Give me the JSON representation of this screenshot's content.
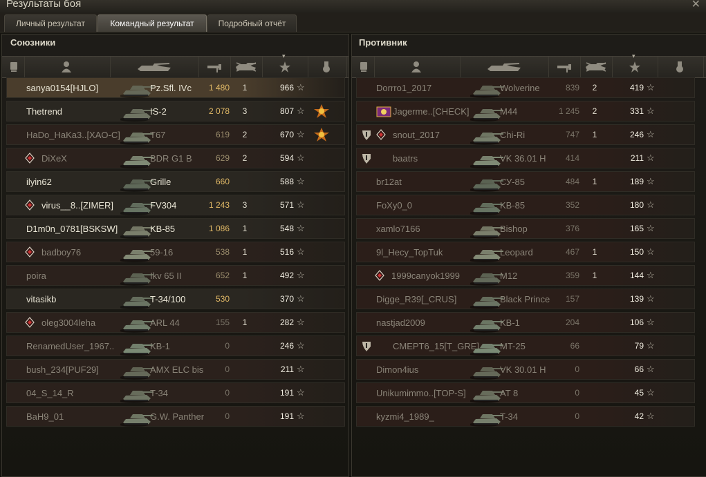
{
  "window": {
    "title": "Результаты боя",
    "close_glyph": "✕"
  },
  "tabs": [
    {
      "label": "Личный результат",
      "active": false
    },
    {
      "label": "Командный результат",
      "active": true
    },
    {
      "label": "Подробный отчёт",
      "active": false
    }
  ],
  "columns": [
    "platoon-icon",
    "player-icon",
    "vehicle-icon",
    "damage-icon",
    "frags-icon",
    "xp-star-icon",
    "medal-icon"
  ],
  "allies": {
    "title": "Союзники",
    "rows": [
      {
        "name": "sanya0154[HJLO]",
        "vehicle": "Pz.Sfl. IVc",
        "damage": "1 480",
        "kills": "1",
        "xp": "966",
        "icon": "",
        "medal": false,
        "player": true
      },
      {
        "name": "Thetrend",
        "vehicle": "IS-2",
        "damage": "2 078",
        "kills": "3",
        "xp": "807",
        "icon": "",
        "medal": true,
        "player": false
      },
      {
        "name": "HaDo_HaKa3..[XAO-C]",
        "vehicle": "T67",
        "damage": "619",
        "kills": "2",
        "xp": "670",
        "icon": "",
        "medal": true,
        "player": false,
        "dead": true
      },
      {
        "name": "DiXeX",
        "vehicle": "BDR G1 B",
        "damage": "629",
        "kills": "2",
        "xp": "594",
        "icon": "diamond",
        "medal": false,
        "player": false,
        "dead": true
      },
      {
        "name": "ilyin62",
        "vehicle": "Grille",
        "damage": "660",
        "kills": "",
        "xp": "588",
        "icon": "",
        "medal": false,
        "player": false
      },
      {
        "name": "virus__8..[ZIMER]",
        "vehicle": "FV304",
        "damage": "1 243",
        "kills": "3",
        "xp": "571",
        "icon": "diamond",
        "medal": false,
        "player": false
      },
      {
        "name": "D1m0n_0781[BSKSW]",
        "vehicle": "KB-85",
        "damage": "1 086",
        "kills": "1",
        "xp": "548",
        "icon": "",
        "medal": false,
        "player": false
      },
      {
        "name": "badboy76",
        "vehicle": "59-16",
        "damage": "538",
        "kills": "1",
        "xp": "516",
        "icon": "diamond",
        "medal": false,
        "player": false,
        "dead": true
      },
      {
        "name": "poira",
        "vehicle": "Ikv 65 II",
        "damage": "652",
        "kills": "1",
        "xp": "492",
        "icon": "",
        "medal": false,
        "player": false,
        "dead": true
      },
      {
        "name": "vitasikb",
        "vehicle": "T-34/100",
        "damage": "530",
        "kills": "",
        "xp": "370",
        "icon": "",
        "medal": false,
        "player": false
      },
      {
        "name": "oleg3004leha",
        "vehicle": "ARL 44",
        "damage": "155",
        "kills": "1",
        "xp": "282",
        "icon": "diamond",
        "medal": false,
        "player": false,
        "dead": true
      },
      {
        "name": "RenamedUser_1967..",
        "vehicle": "KB-1",
        "damage": "0",
        "kills": "",
        "xp": "246",
        "icon": "",
        "medal": false,
        "player": false,
        "dead": true
      },
      {
        "name": "bush_234[PUF29]",
        "vehicle": "AMX ELC bis",
        "damage": "0",
        "kills": "",
        "xp": "211",
        "icon": "",
        "medal": false,
        "player": false,
        "dead": true
      },
      {
        "name": "04_S_14_R",
        "vehicle": "T-34",
        "damage": "0",
        "kills": "",
        "xp": "191",
        "icon": "",
        "medal": false,
        "player": false,
        "dead": true
      },
      {
        "name": "BaH9_01",
        "vehicle": "G.W. Panther",
        "damage": "0",
        "kills": "",
        "xp": "191",
        "icon": "",
        "medal": false,
        "player": false,
        "dead": true
      }
    ]
  },
  "enemies": {
    "title": "Противник",
    "rows": [
      {
        "name": "Dorrro1_2017",
        "vehicle": "Wolverine",
        "damage": "839",
        "kills": "2",
        "xp": "419",
        "icon": "",
        "dead": true
      },
      {
        "name": "Jagerme..[CHECK]",
        "vehicle": "M44",
        "damage": "1 245",
        "kills": "2",
        "xp": "331",
        "icon": "clan",
        "dead": true
      },
      {
        "name": "snout_2017",
        "vehicle": "Chi-Ri",
        "damage": "747",
        "kills": "1",
        "xp": "246",
        "icon": "diamond",
        "badge": "shield",
        "dead": true
      },
      {
        "name": "baatrs",
        "vehicle": "VK 36.01 H",
        "damage": "414",
        "kills": "",
        "xp": "211",
        "icon": "",
        "badge": "shield",
        "dead": true
      },
      {
        "name": "br12at",
        "vehicle": "СУ-85",
        "damage": "484",
        "kills": "1",
        "xp": "189",
        "icon": "",
        "dead": true
      },
      {
        "name": "FoXy0_0",
        "vehicle": "KB-85",
        "damage": "352",
        "kills": "",
        "xp": "180",
        "icon": "",
        "dead": true
      },
      {
        "name": "xamlo7166",
        "vehicle": "Bishop",
        "damage": "376",
        "kills": "",
        "xp": "165",
        "icon": "",
        "dead": true
      },
      {
        "name": "9l_Hecy_TopTuk",
        "vehicle": "Leopard",
        "damage": "467",
        "kills": "1",
        "xp": "150",
        "icon": "",
        "dead": true
      },
      {
        "name": "1999canyok1999",
        "vehicle": "M12",
        "damage": "359",
        "kills": "1",
        "xp": "144",
        "icon": "diamond",
        "dead": true
      },
      {
        "name": "Digge_R39[_CRUS]",
        "vehicle": "Black Prince",
        "damage": "157",
        "kills": "",
        "xp": "139",
        "icon": "",
        "dead": true
      },
      {
        "name": "nastjad2009",
        "vehicle": "KB-1",
        "damage": "204",
        "kills": "",
        "xp": "106",
        "icon": "",
        "dead": true
      },
      {
        "name": "CMEPT6_15[T_GRE]",
        "vehicle": "MT-25",
        "damage": "66",
        "kills": "",
        "xp": "79",
        "icon": "",
        "badge": "shield",
        "dead": true
      },
      {
        "name": "Dimon4ius",
        "vehicle": "VK 30.01 H",
        "damage": "0",
        "kills": "",
        "xp": "66",
        "icon": "",
        "dead": true
      },
      {
        "name": "Unikumimmo..[TOP-S]",
        "vehicle": "AT 8",
        "damage": "0",
        "kills": "",
        "xp": "45",
        "icon": "",
        "dead": true
      },
      {
        "name": "kyzmi4_1989_",
        "vehicle": "T-34",
        "damage": "0",
        "kills": "",
        "xp": "42",
        "icon": "",
        "dead": true
      }
    ]
  },
  "star_glyph": "☆",
  "colors": {
    "alive_name": "#e8e4d4",
    "dead_name": "#8a8478",
    "damage_gold": "#e0b866",
    "damage_dim": "#7a7468",
    "player_row": "#4a3d2c",
    "ally_row": "#2a2721",
    "ally_row_dead": "#2b211c",
    "enemy_row": "#2b1e19"
  }
}
